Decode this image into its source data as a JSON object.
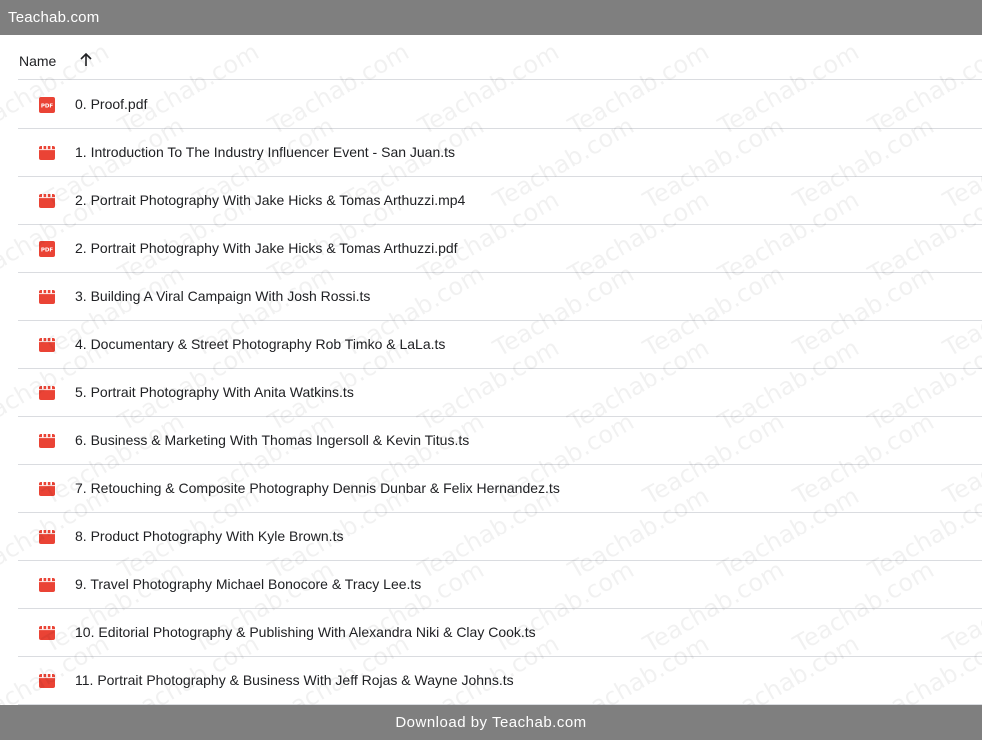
{
  "site": {
    "title": "Teachab.com"
  },
  "header": {
    "name_label": "Name",
    "sort_icon": "arrow-up-icon"
  },
  "files": [
    {
      "name": "0. Proof.pdf",
      "type": "pdf"
    },
    {
      "name": "1. Introduction To The Industry Influencer Event - San Juan.ts",
      "type": "video"
    },
    {
      "name": "2. Portrait Photography With Jake Hicks & Tomas Arthuzzi.mp4",
      "type": "video"
    },
    {
      "name": "2. Portrait Photography With Jake Hicks & Tomas Arthuzzi.pdf",
      "type": "pdf"
    },
    {
      "name": "3. Building A Viral Campaign With Josh Rossi.ts",
      "type": "video"
    },
    {
      "name": "4. Documentary & Street Photography Rob Timko & LaLa.ts",
      "type": "video"
    },
    {
      "name": "5. Portrait Photography With Anita Watkins.ts",
      "type": "video"
    },
    {
      "name": "6. Business & Marketing With Thomas Ingersoll & Kevin Titus.ts",
      "type": "video"
    },
    {
      "name": "7. Retouching & Composite Photography Dennis Dunbar & Felix Hernandez.ts",
      "type": "video"
    },
    {
      "name": "8. Product Photography With Kyle Brown.ts",
      "type": "video"
    },
    {
      "name": "9. Travel Photography Michael Bonocore & Tracy Lee.ts",
      "type": "video"
    },
    {
      "name": "10. Editorial Photography & Publishing With Alexandra Niki & Clay Cook.ts",
      "type": "video"
    },
    {
      "name": "11. Portrait Photography & Business With Jeff Rojas & Wayne Johns.ts",
      "type": "video"
    }
  ],
  "icons": {
    "pdf": "pdf-file-icon",
    "video": "video-file-icon"
  },
  "icon_labels": {
    "pdf": "PDF"
  },
  "colors": {
    "bar": "#7f7f7f",
    "icon_red": "#ea4335",
    "text": "#202124",
    "divider": "#dadce0"
  },
  "footer": {
    "text": "Download by Teachab.com"
  }
}
